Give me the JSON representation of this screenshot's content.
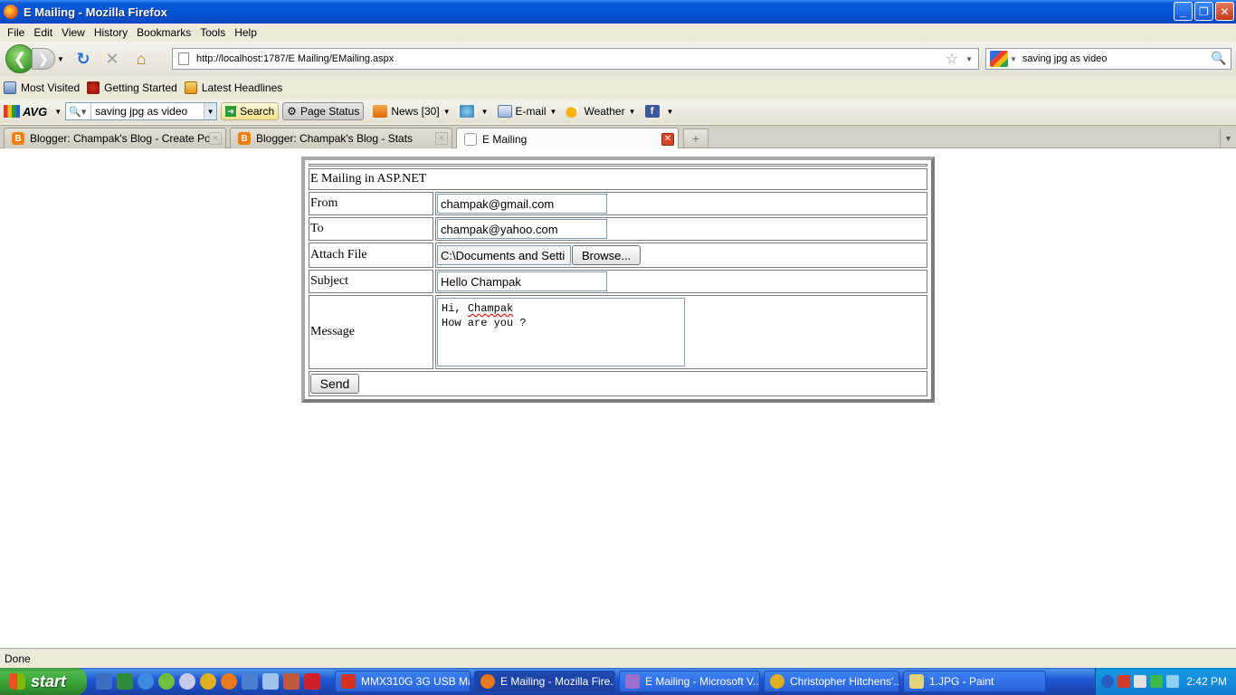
{
  "window": {
    "title": "E Mailing - Mozilla Firefox"
  },
  "menu": [
    "File",
    "Edit",
    "View",
    "History",
    "Bookmarks",
    "Tools",
    "Help"
  ],
  "nav": {
    "url": "http://localhost:1787/E Mailing/EMailing.aspx",
    "search_value": "saving jpg as video"
  },
  "bookmarks": [
    "Most Visited",
    "Getting Started",
    "Latest Headlines"
  ],
  "avg": {
    "logo": "AVG",
    "search_value": "saving jpg as video",
    "search_button": "Search",
    "page_status": "Page Status",
    "news": "News [30]",
    "email": "E-mail",
    "weather": "Weather"
  },
  "tabs": [
    {
      "label": "Blogger: Champak's Blog - Create Post"
    },
    {
      "label": "Blogger: Champak's Blog - Stats"
    },
    {
      "label": "E Mailing"
    }
  ],
  "form": {
    "heading": "E Mailing in ASP.NET",
    "from_label": "From",
    "from_value": "champak@gmail.com",
    "to_label": "To",
    "to_value": "champak@yahoo.com",
    "attach_label": "Attach File",
    "attach_value": "C:\\Documents and Setti",
    "browse_label": "Browse...",
    "subject_label": "Subject",
    "subject_value": "Hello Champak",
    "message_label": "Message",
    "message_line1_prefix": "Hi, ",
    "message_line1_word": "Champak",
    "message_line2": "How are you ?",
    "send_label": "Send"
  },
  "status": {
    "text": "Done"
  },
  "taskbar": {
    "start_label": "start",
    "tasks": [
      {
        "label": "MMX310G 3G USB Ma..."
      },
      {
        "label": "E Mailing - Mozilla Fire..."
      },
      {
        "label": "E Mailing - Microsoft V..."
      },
      {
        "label": "Christopher Hitchens'..."
      },
      {
        "label": "1.JPG - Paint"
      }
    ],
    "clock": "2:42 PM"
  }
}
